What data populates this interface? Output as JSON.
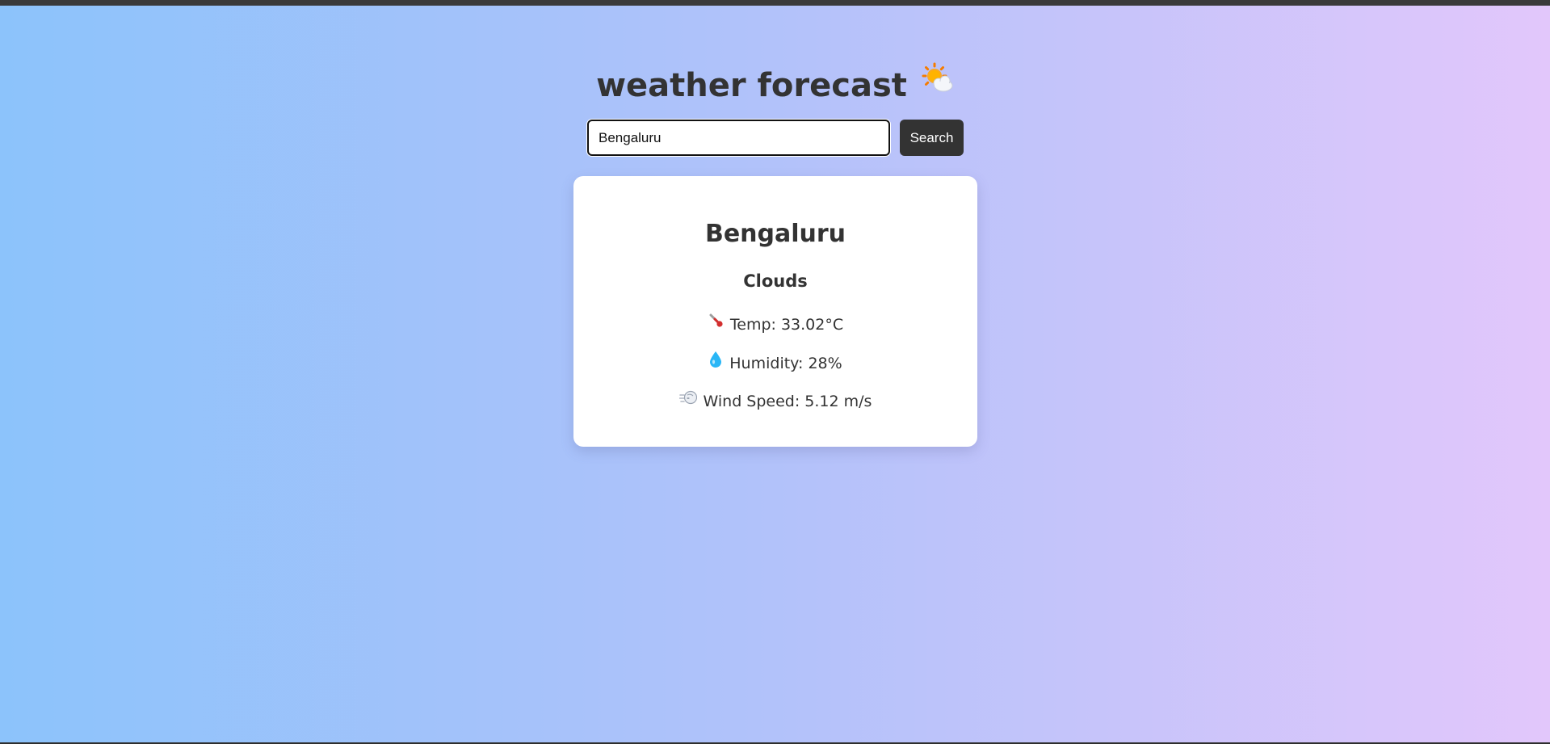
{
  "header": {
    "title": "weather forecast",
    "title_icon": "sun-behind-cloud-icon"
  },
  "search": {
    "value": "Bengaluru",
    "button_label": "Search"
  },
  "weather": {
    "city": "Bengaluru",
    "condition": "Clouds",
    "temp_text": "Temp: 33.02°C",
    "humidity_text": "Humidity: 28%",
    "wind_text": "Wind Speed: 5.12 m/s",
    "temp_icon": "thermometer-icon",
    "humidity_icon": "droplet-icon",
    "wind_icon": "wind-face-icon"
  },
  "colors": {
    "background_start": "#8cc3fb",
    "background_end": "#e2c7fb",
    "text": "#333333",
    "button_bg": "#333333",
    "card_bg": "#ffffff"
  }
}
